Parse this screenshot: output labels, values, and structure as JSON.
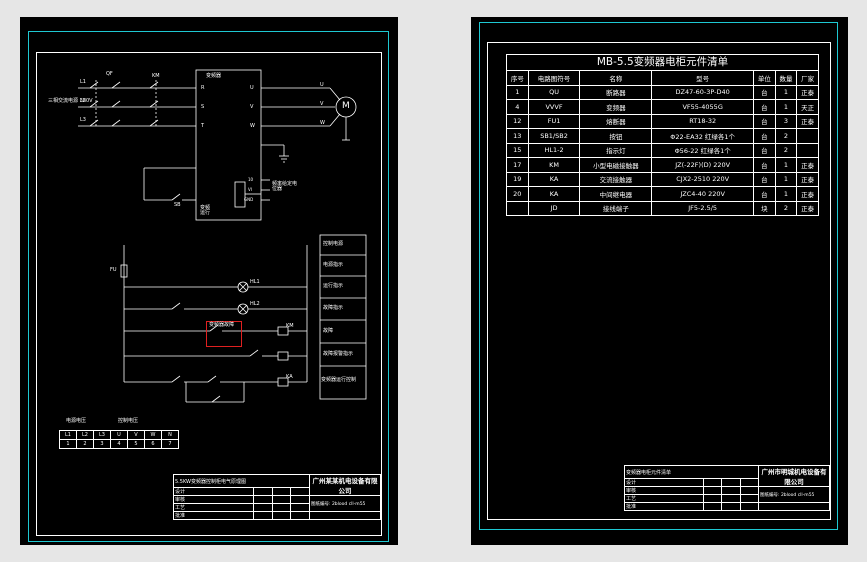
{
  "colors": {
    "background": "#000000",
    "border": "#1ec8d2",
    "line": "#ffffff",
    "highlight": "#e02020",
    "window": "#e6e6e6"
  },
  "left_sheet": {
    "top_circuit": {
      "supply_label": "三相交流电源 380V",
      "phase_labels": [
        "L1",
        "L2",
        "L3"
      ],
      "qf_label": "QF",
      "km_label": "KM",
      "vfd_label": "变频器",
      "vfd_terminals_left": [
        "R",
        "S",
        "T"
      ],
      "vfd_terminals_right": [
        "U",
        "V",
        "W"
      ],
      "motor_wires": [
        "U",
        "V",
        "W"
      ],
      "motor_label": "M",
      "ground_label": "PE",
      "pot_label": "频率给定电位器",
      "stop_label": "SB",
      "run_label": "变频运行",
      "terminal_labels": [
        "10",
        "VI",
        "GND",
        "FWD",
        "COM"
      ]
    },
    "control_circuit": {
      "fuse_label": "FU",
      "rows": [
        {
          "contact": "HL1",
          "label": "指示灯"
        },
        {
          "contact": "HL2",
          "label": "运行指示"
        },
        {
          "contact": "KM",
          "label": "故障报警"
        },
        {
          "contact": "KA",
          "label": "变频器运行"
        }
      ],
      "red_box_label": "变频器故障",
      "legend": [
        "控制电源",
        "电源指示",
        "运行指示",
        "故障指示",
        "故障",
        "故障报警指示",
        "变频器运行控制"
      ]
    },
    "voltage_table": {
      "header_left": "电源电压",
      "header_right": "控制电压",
      "row1": [
        "L1",
        "L2",
        "L3",
        "U",
        "V",
        "W",
        "N"
      ],
      "row2": [
        "1",
        "2",
        "3",
        "4",
        "5",
        "6",
        "7"
      ]
    },
    "title_block": {
      "drawing_title": "5.5KW变频器控制柜电气原理图",
      "company": "广州某某机电设备有限公司",
      "rows": [
        "设计",
        "审核",
        "工艺",
        "批准"
      ],
      "footer": "图纸编号: 2blood cll-m55"
    }
  },
  "right_sheet": {
    "bom": {
      "title": "MB-5.5变频器电柜元件清单",
      "headers": [
        "序号",
        "电路图符号",
        "名称",
        "型号",
        "单位",
        "数量",
        "厂家"
      ],
      "rows": [
        [
          "1",
          "QU",
          "断路器",
          "DZ47-60-3P-D40",
          "台",
          "1",
          "正泰"
        ],
        [
          "4",
          "VVVF",
          "变频器",
          "VF55-4055G",
          "台",
          "1",
          "天正"
        ],
        [
          "12",
          "FU1",
          "熔断器",
          "RT18-32",
          "台",
          "3",
          "正泰"
        ],
        [
          "13",
          "SB1/SB2",
          "按钮",
          "Φ22-EA32  红绿各1个",
          "台",
          "2",
          ""
        ],
        [
          "15",
          "HL1-2",
          "指示灯",
          "Φ56-22  红绿各1个",
          "台",
          "2",
          ""
        ],
        [
          "17",
          "KM",
          "小型电磁接触器",
          "JZ(-22F)(D)  220V",
          "台",
          "1",
          "正泰"
        ],
        [
          "19",
          "KA",
          "交流接触器",
          "CJX2-2510  220V",
          "台",
          "1",
          "正泰"
        ],
        [
          "20",
          "KA",
          "中间继电器",
          "JZC4-40  220V",
          "台",
          "1",
          "正泰"
        ],
        [
          "",
          "JD",
          "接线端子",
          "JF5-2.5/5",
          "块",
          "2",
          "正泰"
        ]
      ]
    },
    "title_block": {
      "drawing_title": "变频器电柜元件清单",
      "company": "广州市明城机电设备有限公司",
      "rows": [
        "设计",
        "审核",
        "工艺",
        "批准"
      ],
      "footer": "图纸编号: 2blood cll-m55"
    }
  }
}
